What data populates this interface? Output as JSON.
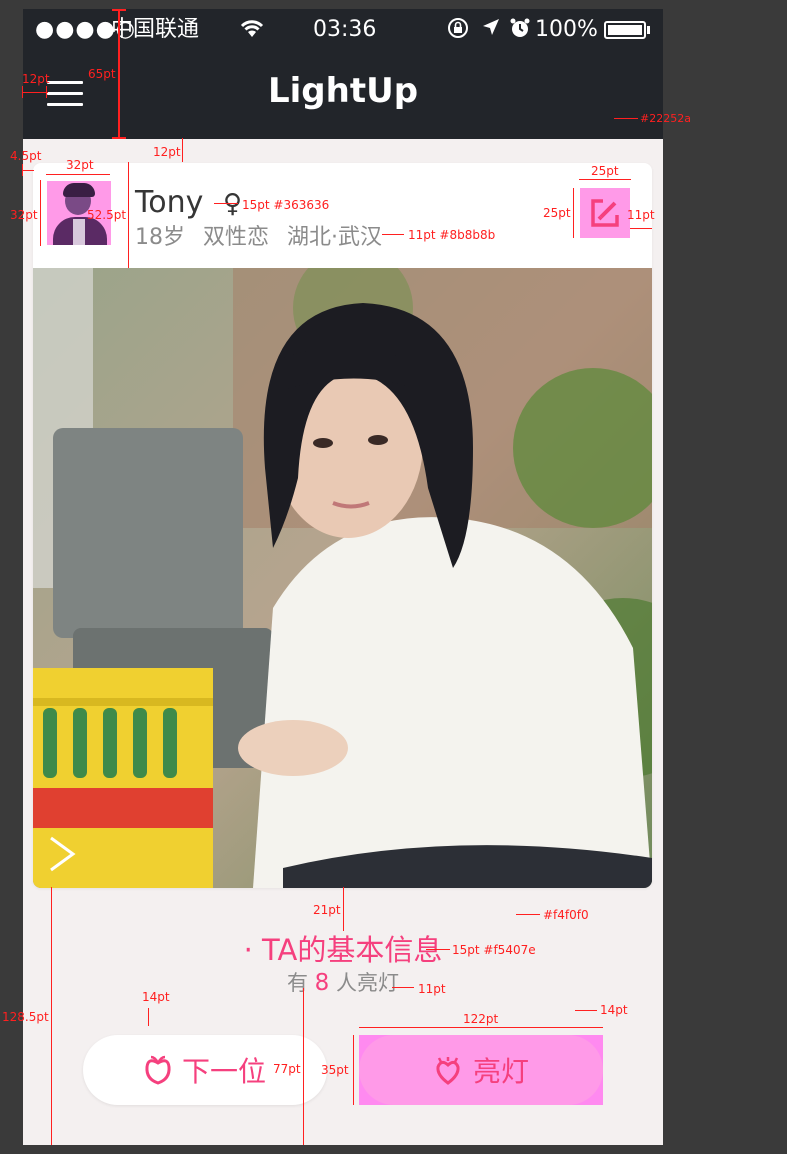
{
  "status_bar": {
    "signal": "●●●●○",
    "carrier": "中国联通",
    "wifi_icon": "wifi-icon",
    "time": "03:36",
    "battery": "100%"
  },
  "header": {
    "title": "LightUp",
    "menu_icon": "hamburger-menu-icon",
    "background": "#22252a"
  },
  "profile": {
    "name": "Tony",
    "gender_symbol": "♀",
    "age": "18岁",
    "orientation": "双性恋",
    "location": "湖北·武汉",
    "name_color": "#363636",
    "info_color": "#8b8b8b"
  },
  "section": {
    "title": "· TA的基本信息",
    "count_prefix": "有",
    "count_value": "8",
    "count_suffix": "人亮灯",
    "accent": "#f5407e"
  },
  "buttons": {
    "next_label": "下一位",
    "light_label": "亮灯"
  },
  "colors": {
    "background": "#f4f0f0",
    "accent": "#f5407e",
    "header": "#22252a"
  },
  "annotations": {
    "a_12pt_left": "12pt",
    "a_65pt": "65pt",
    "a_22252a": "#22252a",
    "a_4_5pt": "4.5pt",
    "a_12pt_gap": "12pt",
    "a_32pt_w": "32pt",
    "a_32pt_h": "32pt",
    "a_52_5pt": "52.5pt",
    "a_15pt_363636": "15pt #363636",
    "a_11pt_8b8b8b": "11pt #8b8b8b",
    "a_25pt_w": "25pt",
    "a_25pt_h": "25pt",
    "a_11pt_right": "11pt",
    "a_21pt": "21pt",
    "a_f4f0f0": "#f4f0f0",
    "a_15pt_f5407e": "15pt #f5407e",
    "a_11pt_count": "11pt",
    "a_128_5pt": "128.5pt",
    "a_14pt_left": "14pt",
    "a_14pt_right": "14pt",
    "a_122pt": "122pt",
    "a_77pt": "77pt",
    "a_35pt": "35pt"
  }
}
